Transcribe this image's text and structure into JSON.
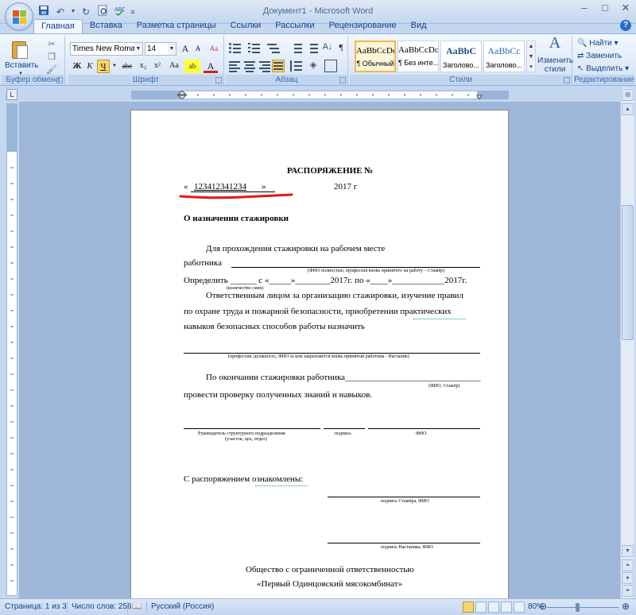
{
  "window": {
    "title": "Документ1 - Microsoft Word",
    "controls": [
      "–",
      "□",
      "✕"
    ]
  },
  "quick_access": [
    "save-icon",
    "undo-icon",
    "redo-icon",
    "print-preview-icon",
    "spelling-icon",
    "customize-icon"
  ],
  "tabs": [
    "Главная",
    "Вставка",
    "Разметка страницы",
    "Ссылки",
    "Рассылки",
    "Рецензирование",
    "Вид"
  ],
  "active_tab": "Главная",
  "ribbon": {
    "clipboard": {
      "paste_label": "Вставить",
      "group_label": "Буфер обмена"
    },
    "font": {
      "font_name": "Times New Roman",
      "font_size": "14",
      "group_label": "Шрифт",
      "buttons": {
        "bold": "Ж",
        "italic": "К",
        "underline": "Ч",
        "strike": "abc",
        "sub": "x₂",
        "sup": "x²",
        "case": "Aa",
        "grow": "A",
        "shrink": "A",
        "clear": "Aa",
        "highlight": "ab",
        "color": "A"
      }
    },
    "paragraph": {
      "group_label": "Абзац",
      "show_marks": "¶"
    },
    "styles": {
      "group_label": "Стили",
      "cards": [
        {
          "sample": "AaBbCcDc",
          "name": "¶ Обычный",
          "selected": true
        },
        {
          "sample": "AaBbCcDc",
          "name": "¶ Без инте...",
          "selected": false
        },
        {
          "sample": "AaBbC",
          "name": "Заголово...",
          "selected": false
        },
        {
          "sample": "AaBbCc",
          "name": "Заголово...",
          "selected": false
        }
      ],
      "change_styles": "Изменить стили"
    },
    "editing": {
      "group_label": "Редактирование",
      "find": "Найти",
      "replace": "Заменить",
      "select": "Выделить"
    }
  },
  "document": {
    "title": "РАСПОРЯЖЕНИЕ №",
    "date_prefix": "«",
    "date_value": "123412341234",
    "date_suffix": "»",
    "year": "2017 г",
    "subject": "О назначении стажировки",
    "p1": "Для прохождения стажировки на рабочем месте",
    "worker_label": "работника",
    "hint_worker": "(ФИО полностью, профессия вновь принятого на работу – Стажёр)",
    "define_line": "Определить ______ с «_____»________2017г. по «____»____________2017г.",
    "hint_shifts": "(количество смен)",
    "p2_l1": "Ответственным лицом за организацию стажировки, изучение правил",
    "p2_l2": "по охране труда и пожарной безопасности, приобретении практических",
    "p2_l3": "навыков безопасных способов работы назначить",
    "hint_mentor": "(профессия /должность, ФИО за кем закрепляется вновь принятый работник - Настаник)",
    "p3": "По окончании стажировки работника_______________________________",
    "hint_fio_trainee": "(ФИО, Стажёр)",
    "p3_l2": "провести проверку полученных знаний и навыков.",
    "sig_head": "Руководитель структурного подразделения",
    "sig_head_2": "(участок, цех, отдел)",
    "sig_sign": "подпись",
    "sig_fio": "ФИО",
    "acquainted": "С распоряжением ознакомлены:",
    "sig_trainee": "подпись Стажёра, ФИО",
    "sig_mentor": "подпись Настаника, ФИО",
    "org_line1": "Общество с ограниченной ответственностью",
    "org_line2": "«Первый Одинцовский мясокомбинат»"
  },
  "status": {
    "page": "Страница: 1 из 3",
    "words": "Число слов: 256",
    "language": "Русский (Россия)",
    "zoom": "80%"
  },
  "accent": "#15428b"
}
